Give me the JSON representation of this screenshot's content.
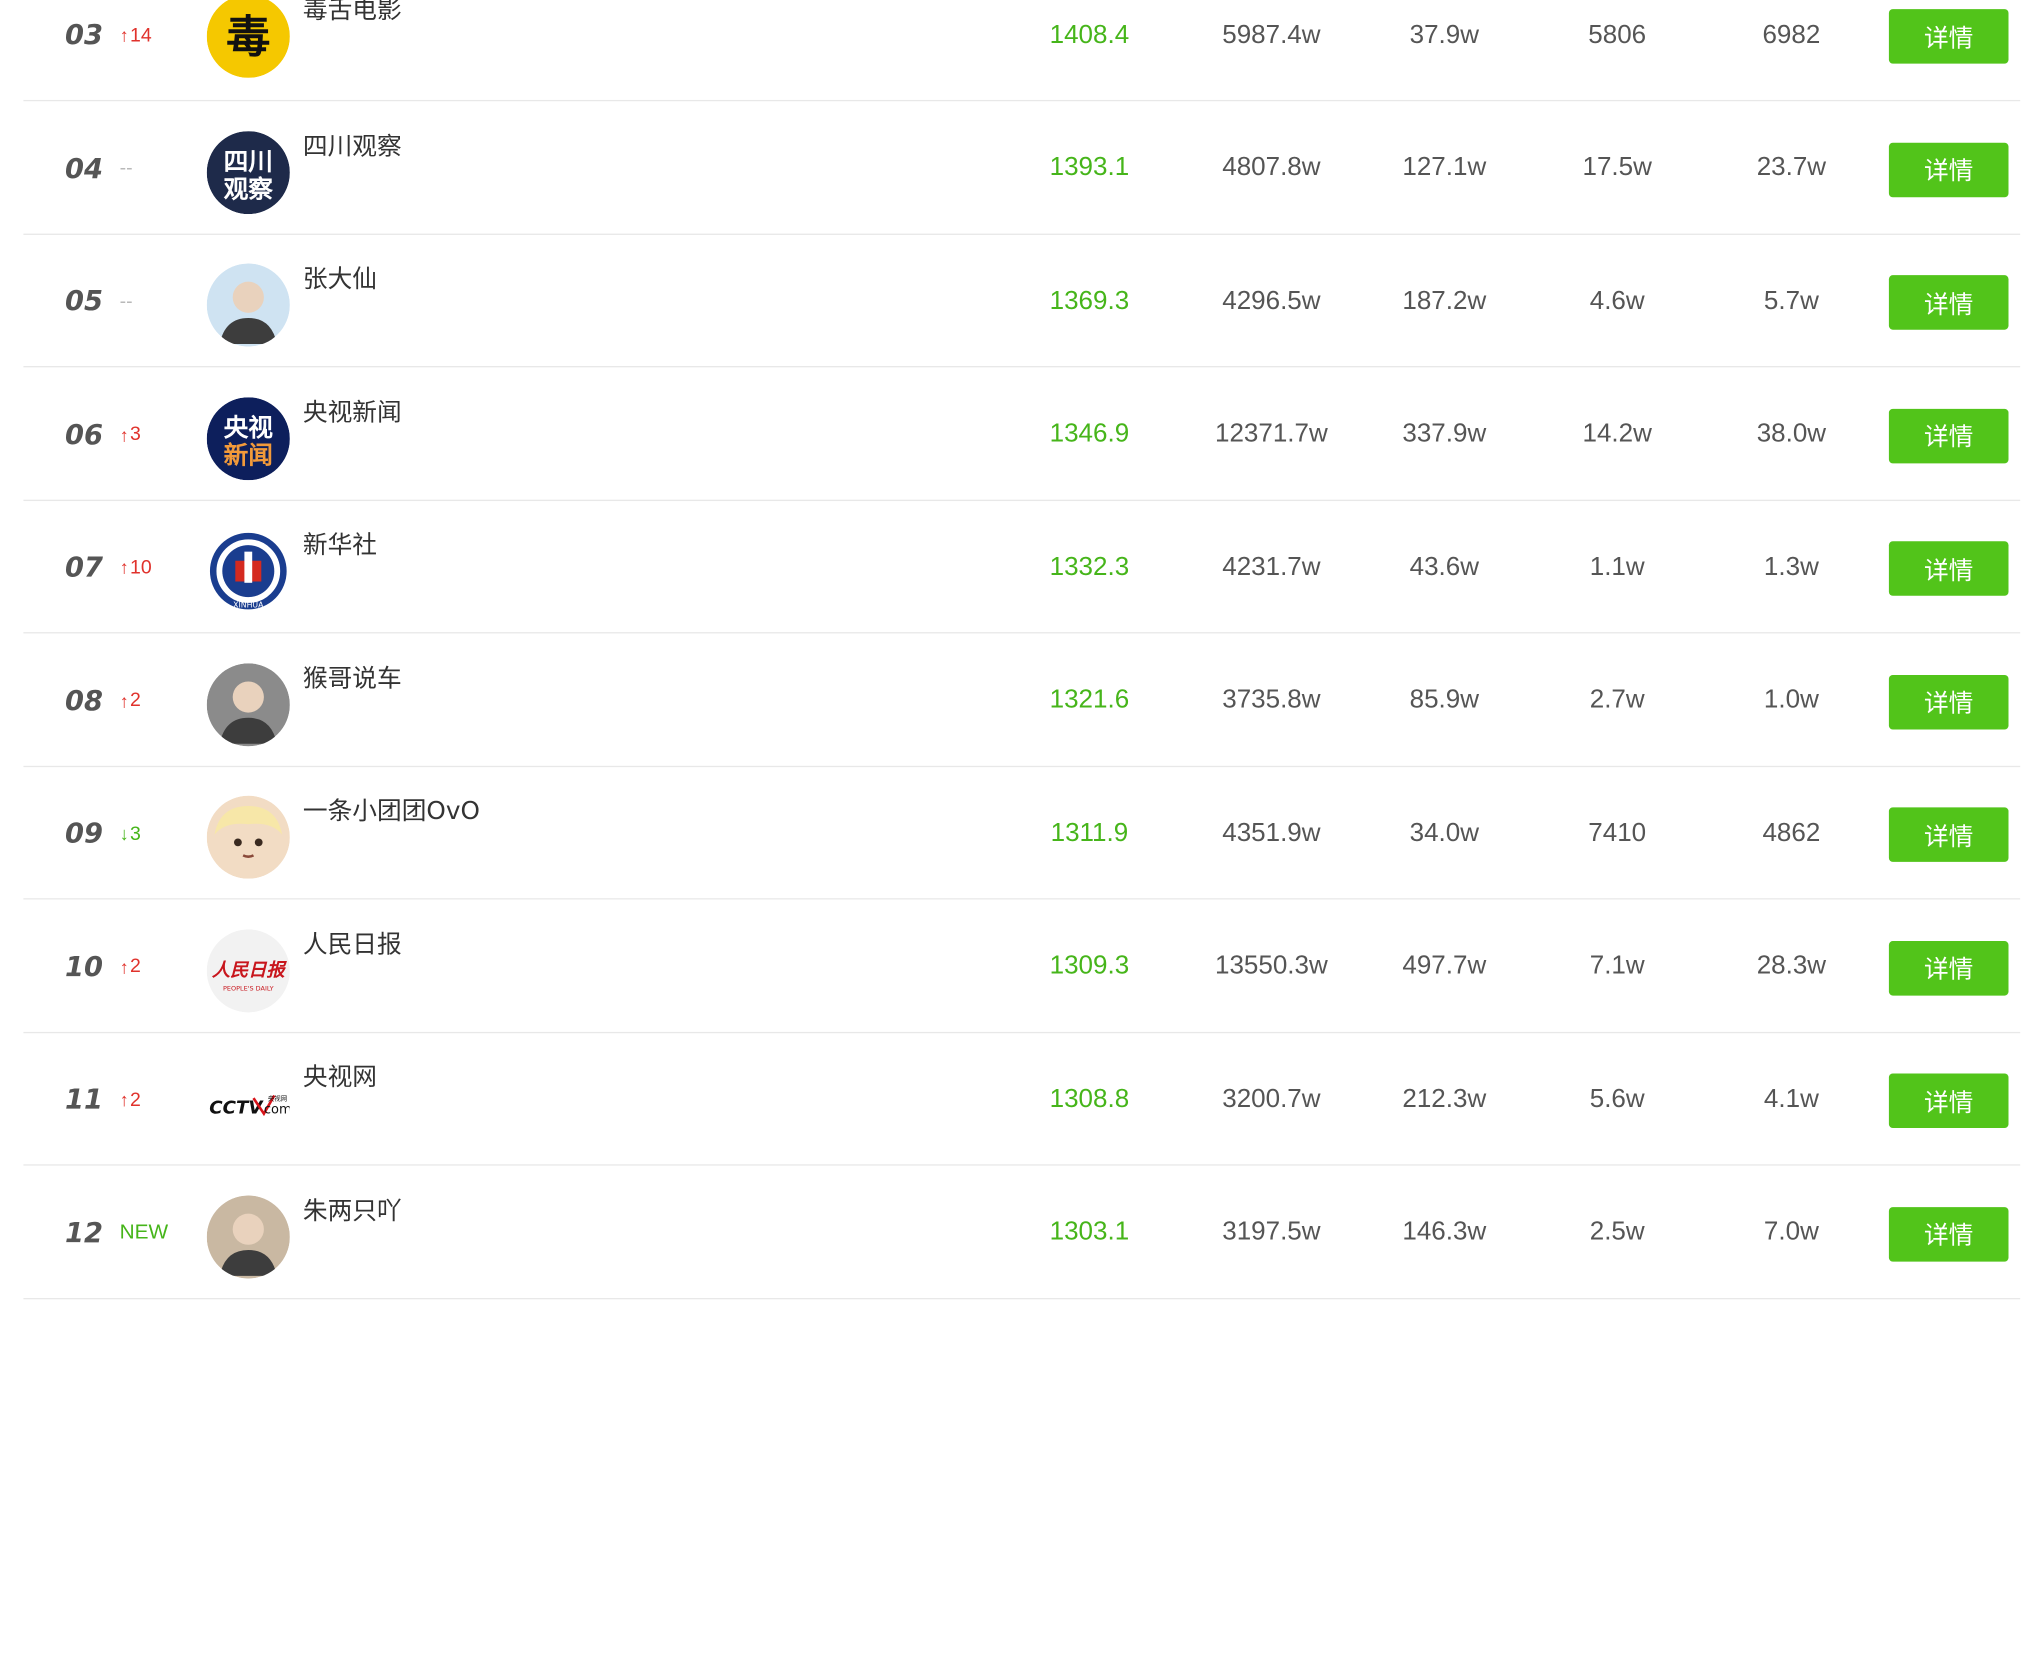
{
  "detail_label": "详情",
  "rows": [
    {
      "rank": "03",
      "change": "14",
      "change_type": "up",
      "name": "毒舌电影",
      "score": "1408.4",
      "fans": "5987.4w",
      "likes": "37.9w",
      "comments": "5806",
      "shares": "6982"
    },
    {
      "rank": "04",
      "change": "--",
      "change_type": "same",
      "name": "四川观察",
      "score": "1393.1",
      "fans": "4807.8w",
      "likes": "127.1w",
      "comments": "17.5w",
      "shares": "23.7w"
    },
    {
      "rank": "05",
      "change": "--",
      "change_type": "same",
      "name": "张大仙",
      "score": "1369.3",
      "fans": "4296.5w",
      "likes": "187.2w",
      "comments": "4.6w",
      "shares": "5.7w"
    },
    {
      "rank": "06",
      "change": "3",
      "change_type": "up",
      "name": "央视新闻",
      "score": "1346.9",
      "fans": "12371.7w",
      "likes": "337.9w",
      "comments": "14.2w",
      "shares": "38.0w"
    },
    {
      "rank": "07",
      "change": "10",
      "change_type": "up",
      "name": "新华社",
      "score": "1332.3",
      "fans": "4231.7w",
      "likes": "43.6w",
      "comments": "1.1w",
      "shares": "1.3w"
    },
    {
      "rank": "08",
      "change": "2",
      "change_type": "up",
      "name": "猴哥说车",
      "score": "1321.6",
      "fans": "3735.8w",
      "likes": "85.9w",
      "comments": "2.7w",
      "shares": "1.0w"
    },
    {
      "rank": "09",
      "change": "3",
      "change_type": "down",
      "name": "一条小团团OvO",
      "score": "1311.9",
      "fans": "4351.9w",
      "likes": "34.0w",
      "comments": "7410",
      "shares": "4862"
    },
    {
      "rank": "10",
      "change": "2",
      "change_type": "up",
      "name": "人民日报",
      "score": "1309.3",
      "fans": "13550.3w",
      "likes": "497.7w",
      "comments": "7.1w",
      "shares": "28.3w"
    },
    {
      "rank": "11",
      "change": "2",
      "change_type": "up",
      "name": "央视网",
      "score": "1308.8",
      "fans": "3200.7w",
      "likes": "212.3w",
      "comments": "5.6w",
      "shares": "4.1w"
    },
    {
      "rank": "12",
      "change": "NEW",
      "change_type": "new",
      "name": "朱两只吖",
      "score": "1303.1",
      "fans": "3197.5w",
      "likes": "146.3w",
      "comments": "2.5w",
      "shares": "7.0w"
    }
  ],
  "avatars": {
    "0": {
      "icon": "dushe-logo-icon",
      "glyph": "毒",
      "bg": "#f5c800",
      "fg": "#111111"
    },
    "1": {
      "icon": "sichuan-guancha-logo-icon",
      "line1": "四川",
      "line2": "观察",
      "bg": "#1e2a4a",
      "fg": "#ffffff"
    },
    "2": {
      "icon": "portrait-photo-icon",
      "bg": "#cfe3f2"
    },
    "3": {
      "icon": "cctv-news-logo-icon",
      "line1": "央视",
      "line2": "新闻",
      "bg": "#0d1f5c",
      "fg": "#ffffff",
      "accent": "#f29a3a"
    },
    "4": {
      "icon": "xinhua-emblem-icon",
      "bg": "#ffffff",
      "ring": "#1a3d8f",
      "accent": "#d42a20",
      "ring_text": "XINHUA"
    },
    "5": {
      "icon": "portrait-photo-icon",
      "bg": "#8b8b8b"
    },
    "6": {
      "icon": "anime-avatar-icon",
      "bg": "#f2dcc4"
    },
    "7": {
      "icon": "peoples-daily-logo-icon",
      "calligraphy": "人民日报",
      "subtitle": "PEOPLE'S DAILY",
      "bg": "#f2f2f2",
      "fg": "#c8161d"
    },
    "8": {
      "icon": "cctv-com-logo-icon",
      "logo_text": "CCTV",
      "small_text": "央视网",
      "suffix": "com",
      "bg": "#ffffff",
      "fg": "#111111",
      "accent": "#d7141a"
    },
    "9": {
      "icon": "portrait-photo-icon",
      "bg": "#c9b8a2"
    }
  }
}
